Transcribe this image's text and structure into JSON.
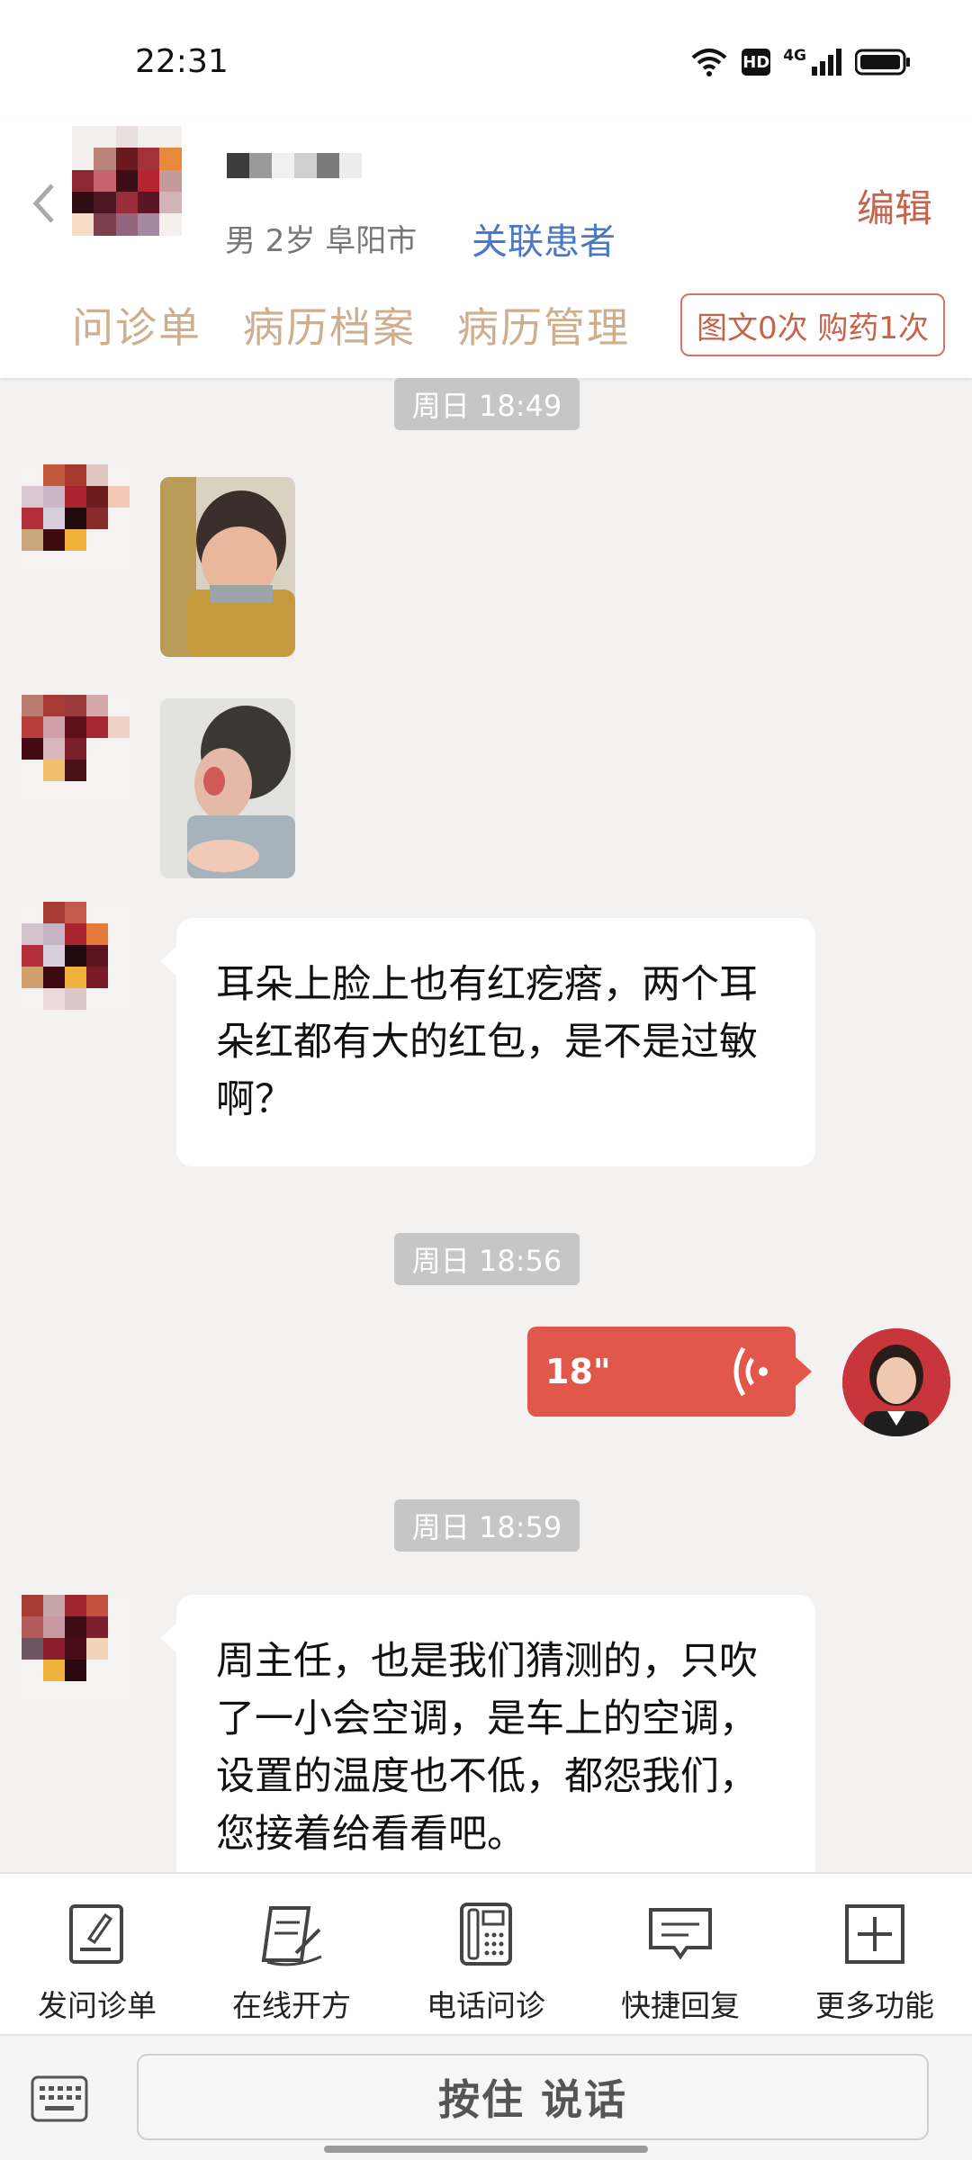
{
  "status_bar": {
    "time": "22:31",
    "hd_label": "HD",
    "network_label": "4G"
  },
  "header": {
    "patient_meta": "男 2岁  阜阳市",
    "link_patient": "关联患者",
    "edit": "编辑",
    "tabs": [
      "问诊单",
      "病历档案",
      "病历管理"
    ],
    "quota": "图文0次 购药1次"
  },
  "chat": {
    "timestamps": [
      "周日 18:49",
      "周日 18:56",
      "周日 18:59"
    ],
    "patient_messages": [
      "耳朵上脸上也有红疙瘩，两个耳朵红都有大的红包，是不是过敏啊？",
      "周主任，也是我们猜测的，只吹了一小会空调，是车上的空调，设置的温度也不低，都怨我们，您接着给看看吧。"
    ],
    "voice_message": {
      "duration": "18\""
    }
  },
  "toolbar": {
    "items": [
      {
        "label": "发问诊单",
        "icon": "form-icon"
      },
      {
        "label": "在线开方",
        "icon": "prescription-icon"
      },
      {
        "label": "电话问诊",
        "icon": "phone-icon"
      },
      {
        "label": "快捷回复",
        "icon": "message-icon"
      },
      {
        "label": "更多功能",
        "icon": "plus-icon"
      }
    ]
  },
  "input_bar": {
    "talk_button": "按住 说话"
  },
  "colors": {
    "accent": "#c5634c",
    "link": "#4a77c6",
    "voice_bubble": "#e1584a",
    "tab_text": "#cfae8e"
  }
}
